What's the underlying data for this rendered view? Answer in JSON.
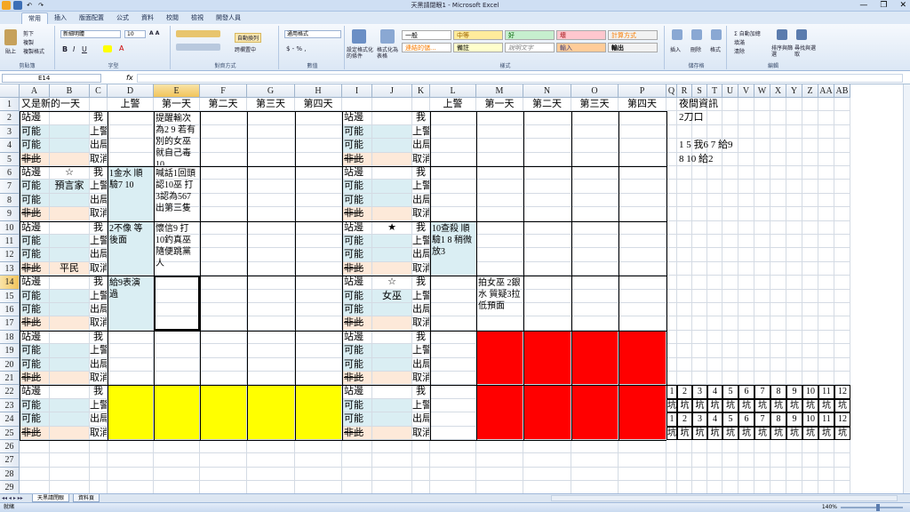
{
  "window": {
    "title": "天黑請閉眼1 - Microsoft Excel",
    "minimize": "—",
    "restore": "❐",
    "close": "✕"
  },
  "tabs": [
    "常用",
    "插入",
    "版面配置",
    "公式",
    "資料",
    "校閱",
    "檢視",
    "開發人員"
  ],
  "ribbon": {
    "clipboard": {
      "label": "剪貼簿",
      "paste": "貼上",
      "cut": "剪下",
      "copy": "複製",
      "format_painter": "複製格式"
    },
    "font": {
      "label": "字型",
      "font_name": "新細明體",
      "font_size": "10"
    },
    "alignment": {
      "label": "對齊方式",
      "wrap": "自動換列",
      "merge": "跨欄置中"
    },
    "number": {
      "label": "數值",
      "format": "通用格式"
    },
    "styles": {
      "label": "樣式",
      "conditional": "設定格式化的條件",
      "table": "格式化為表格",
      "cells": [
        "一般",
        "中等",
        "好",
        "壞",
        "計算方式",
        "連結的儲...",
        "備註",
        "說明文字",
        "輸入",
        "輸出"
      ]
    },
    "cells": {
      "label": "儲存格",
      "insert": "插入",
      "delete": "刪除",
      "format": "格式"
    },
    "editing": {
      "label": "編輯",
      "autosum": "自動加總",
      "fill": "填滿",
      "clear": "清除",
      "sort": "排序與篩選",
      "find": "尋找與選取"
    }
  },
  "formula_bar": {
    "name_box": "E14",
    "fx": "fx",
    "value": ""
  },
  "columns": [
    "A",
    "B",
    "C",
    "D",
    "E",
    "F",
    "G",
    "H",
    "I",
    "J",
    "K",
    "L",
    "M",
    "N",
    "O",
    "P",
    "Q",
    "R",
    "S",
    "T",
    "U",
    "V",
    "W",
    "X",
    "Y",
    "Z",
    "AA",
    "AB"
  ],
  "rows": [
    "1",
    "2",
    "3",
    "4",
    "5",
    "6",
    "7",
    "8",
    "9",
    "10",
    "11",
    "12",
    "13",
    "14",
    "15",
    "16",
    "17",
    "18",
    "19",
    "20",
    "21",
    "22",
    "23",
    "24",
    "25",
    "26",
    "27",
    "28",
    "29"
  ],
  "hidden_rows_note": "",
  "cells": {
    "A1": "又是新的一天",
    "D1": "上警",
    "E1": "第一天",
    "F1": "第二天",
    "G1": "第三天",
    "H1": "第四天",
    "L1": "上警",
    "M1": "第一天",
    "N1": "第二天",
    "O1": "第三天",
    "P1": "第四天",
    "R1": "夜間資訊",
    "R2": "2刀口",
    "R4": "1 5 我6 7 給9",
    "R5": "8 10 給2",
    "label_stand": "站邊",
    "label_maybe": "可能",
    "label_not": "非此",
    "label_me": "我",
    "label_police": "上警",
    "label_out": "出局",
    "label_cancel": "取消",
    "B6": "☆",
    "B7": "預言家",
    "B13": "平民",
    "J10": "★",
    "J14": "☆",
    "J15": "女巫",
    "E2": "提醒輸次為2 9 若有別的女巫就自己毒10",
    "D6": "1金水 順驗7 10",
    "E6": "喊話1回頭認10巫 打3認為567出第三隻",
    "D10": "2不像 等後面",
    "E10": "懷信9 打10釣真巫 隨便跳黨人",
    "D14": "給9表演 過",
    "L10": "10查殺 順驗1 8 稍微放3",
    "M14": "拍女巫 2銀水 質疑3拉低預面",
    "pit_numbers": [
      "1",
      "2",
      "3",
      "4",
      "5",
      "6",
      "7",
      "8",
      "9",
      "10",
      "11",
      "12"
    ],
    "pit_label": "坑"
  },
  "sheet_tabs": [
    "天黑請閉眼",
    "資料頁"
  ],
  "status": {
    "ready": "就緒",
    "zoom": "140%"
  }
}
